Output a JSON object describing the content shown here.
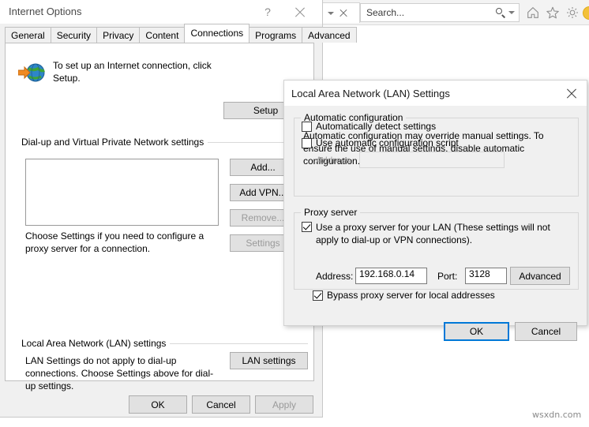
{
  "browser": {
    "tab_controls": {
      "caret_icon": "chevron-down-icon",
      "close_icon": "close-icon"
    },
    "search": {
      "placeholder": "Search...",
      "value": "",
      "icon": "search-icon",
      "caret_icon": "chevron-down-icon"
    },
    "icons": [
      {
        "name": "home-icon",
        "label": "Home"
      },
      {
        "name": "favorites-star-icon",
        "label": "Favorites"
      },
      {
        "name": "gear-icon",
        "label": "Tools"
      }
    ],
    "status_badge": {
      "name": "loading-badge",
      "color": "#f3c13a"
    }
  },
  "internet_options": {
    "title": "Internet Options",
    "help_label": "?",
    "close_icon": "close-icon",
    "tabs": [
      {
        "label": "General",
        "selected": false
      },
      {
        "label": "Security",
        "selected": false
      },
      {
        "label": "Privacy",
        "selected": false
      },
      {
        "label": "Content",
        "selected": false
      },
      {
        "label": "Connections",
        "selected": true
      },
      {
        "label": "Programs",
        "selected": false
      },
      {
        "label": "Advanced",
        "selected": false
      }
    ],
    "setup": {
      "icon": "globe-with-arrow-icon",
      "text": "To set up an Internet connection, click Setup.",
      "button_label": "Setup"
    },
    "dialup_group": {
      "legend": "Dial-up and Virtual Private Network settings",
      "connections": [],
      "buttons": [
        {
          "label": "Add...",
          "enabled": true
        },
        {
          "label": "Add VPN...",
          "enabled": true
        },
        {
          "label": "Remove...",
          "enabled": false
        },
        {
          "label": "Settings",
          "enabled": false
        }
      ],
      "hint": "Choose Settings if you need to configure a proxy server for a connection."
    },
    "lan_group": {
      "legend": "Local Area Network (LAN) settings",
      "hint": "LAN Settings do not apply to dial-up connections. Choose Settings above for dial-up settings.",
      "button_label": "LAN settings"
    },
    "footer": {
      "ok_label": "OK",
      "cancel_label": "Cancel",
      "apply_label": "Apply",
      "apply_enabled": false
    }
  },
  "lan_settings": {
    "title": "Local Area Network (LAN) Settings",
    "close_icon": "close-icon",
    "automatic_configuration": {
      "legend": "Automatic configuration",
      "description": "Automatic configuration may override manual settings.  To ensure the use of manual settings, disable automatic configuration.",
      "auto_detect": {
        "label": "Automatically detect settings",
        "checked": false
      },
      "use_script": {
        "label": "Use automatic configuration script",
        "checked": false
      },
      "address_label": "Address",
      "address_value": "",
      "address_enabled": false
    },
    "proxy_server": {
      "legend": "Proxy server",
      "use_proxy": {
        "label": "Use a proxy server for your LAN (These settings will not apply to dial-up or VPN connections).",
        "checked": true
      },
      "address_label": "Address:",
      "address_value": "192.168.0.14",
      "port_label": "Port:",
      "port_value": "3128",
      "advanced_label": "Advanced",
      "bypass": {
        "label": "Bypass proxy server for local addresses",
        "checked": true
      }
    },
    "footer": {
      "ok_label": "OK",
      "cancel_label": "Cancel",
      "ok_focused": true
    }
  },
  "watermark": "wsxdn.com"
}
